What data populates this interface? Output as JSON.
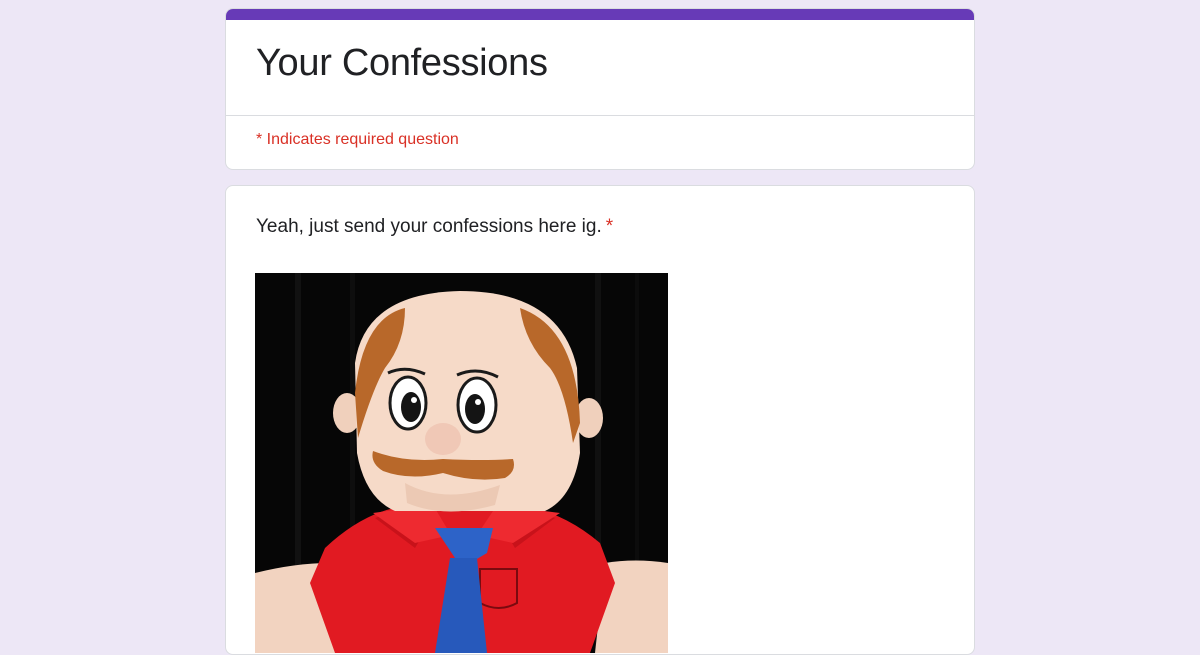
{
  "form": {
    "title": "Your Confessions",
    "required_note": "* Indicates required question",
    "accent_color": "#673ab7",
    "background_color": "#ede7f6"
  },
  "question": {
    "label": "Yeah, just send your confessions here ig.",
    "required_marker": "*",
    "image_icon": "puppet-image"
  }
}
